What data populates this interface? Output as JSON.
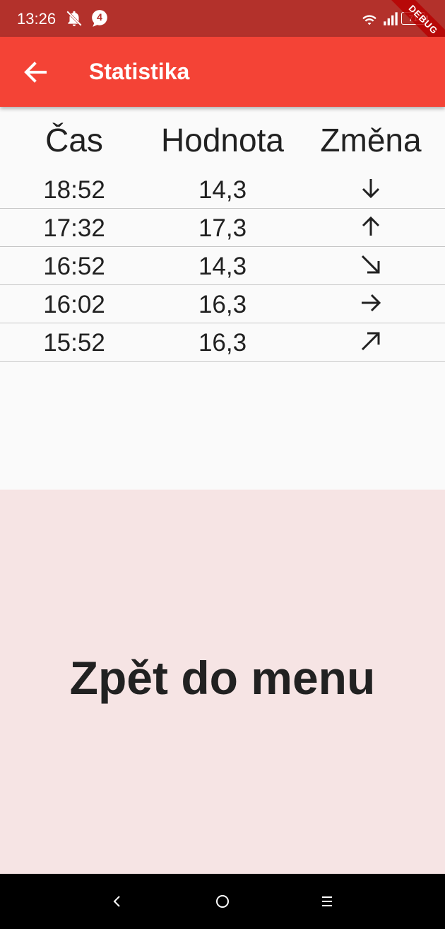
{
  "status_bar": {
    "time": "13:26",
    "notification_count": "4",
    "battery": "71",
    "icons": [
      "notifications-off-icon",
      "chat-badge-icon",
      "wifi-icon",
      "signal-icon",
      "battery-icon"
    ]
  },
  "debug_banner": "DEBUG",
  "app_bar": {
    "title": "Statistika",
    "back_icon": "arrow-back-icon"
  },
  "table": {
    "headers": [
      "Čas",
      "Hodnota",
      "Změna"
    ],
    "rows": [
      {
        "time": "18:52",
        "value": "14,3",
        "change": "arrow-down-icon"
      },
      {
        "time": "17:32",
        "value": "17,3",
        "change": "arrow-up-icon"
      },
      {
        "time": "16:52",
        "value": "14,3",
        "change": "arrow-down-right-icon"
      },
      {
        "time": "16:02",
        "value": "16,3",
        "change": "arrow-right-icon"
      },
      {
        "time": "15:52",
        "value": "16,3",
        "change": "arrow-up-right-icon"
      }
    ]
  },
  "menu_button": {
    "label": "Zpět do menu"
  },
  "nav_bar": {
    "icons": [
      "back-nav-icon",
      "home-nav-icon",
      "recents-nav-icon"
    ]
  },
  "colors": {
    "status_bar": "#b3312b",
    "app_bar": "#f44336",
    "button_background": "#f6e4e4",
    "text": "#212121"
  }
}
